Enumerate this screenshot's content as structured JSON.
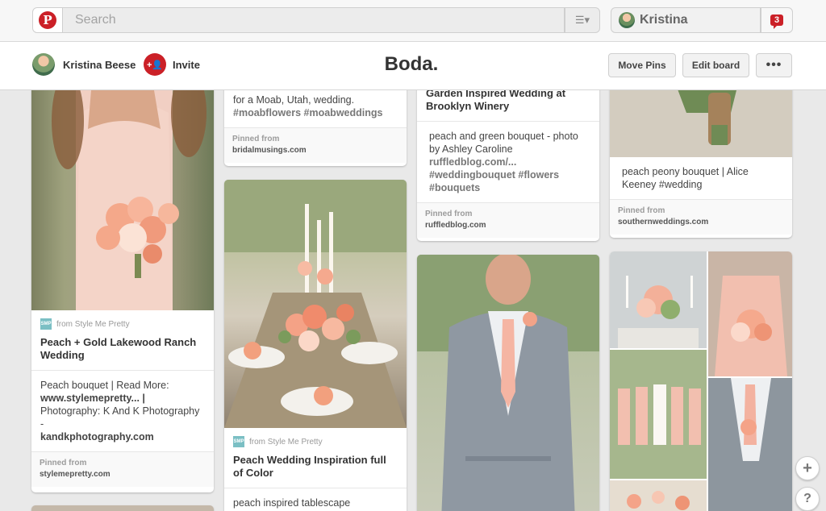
{
  "topbar": {
    "search_placeholder": "Search",
    "user_name": "Kristina",
    "notification_count": "3"
  },
  "board": {
    "owner_name": "Kristina Beese",
    "invite_label": "Invite",
    "title": "Boda.",
    "move_pins_label": "Move Pins",
    "edit_board_label": "Edit board",
    "more_label": "•••"
  },
  "pins": {
    "p1": {
      "from": "from Style Me Pretty",
      "title": "Peach + Gold Lakewood Ranch Wedding",
      "desc_plain": "Peach bouquet | Read More:",
      "desc_link": "www.stylemepretty... |",
      "desc_plain2": "Photography: K And K Photography -",
      "desc_link2": "kandkphotography.com",
      "pinned_from_label": "Pinned from",
      "source": "stylemepretty.com"
    },
    "p2": {
      "desc_plain": "for a Moab, Utah, wedding.",
      "desc_tags": "#moabflowers #moabweddings",
      "pinned_from_label": "Pinned from",
      "source": "bridalmusings.com"
    },
    "p3": {
      "from": "from Style Me Pretty",
      "title": "Peach Wedding Inspiration full of Color",
      "desc_plain": "peach inspired tablescape"
    },
    "p4": {
      "title": "Garden Inspired Wedding at Brooklyn Winery",
      "desc_plain": "peach and green bouquet - photo by Ashley Caroline",
      "desc_link": "ruffledblog.com/...",
      "desc_tags": "#weddingbouquet #flowers #bouquets",
      "pinned_from_label": "Pinned from",
      "source": "ruffledblog.com"
    },
    "p5": {
      "desc_plain": "peach peony bouquet | Alice Keeney",
      "desc_tags": "#wedding",
      "pinned_from_label": "Pinned from",
      "source": "southernweddings.com"
    }
  },
  "fabs": {
    "add": "+",
    "help": "?"
  },
  "icons": {
    "logo": "pinterest-logo-icon",
    "menu": "menu-icon",
    "invite": "add-person-icon"
  },
  "colors": {
    "brand": "#cb2027",
    "background": "#e9e9e9"
  }
}
